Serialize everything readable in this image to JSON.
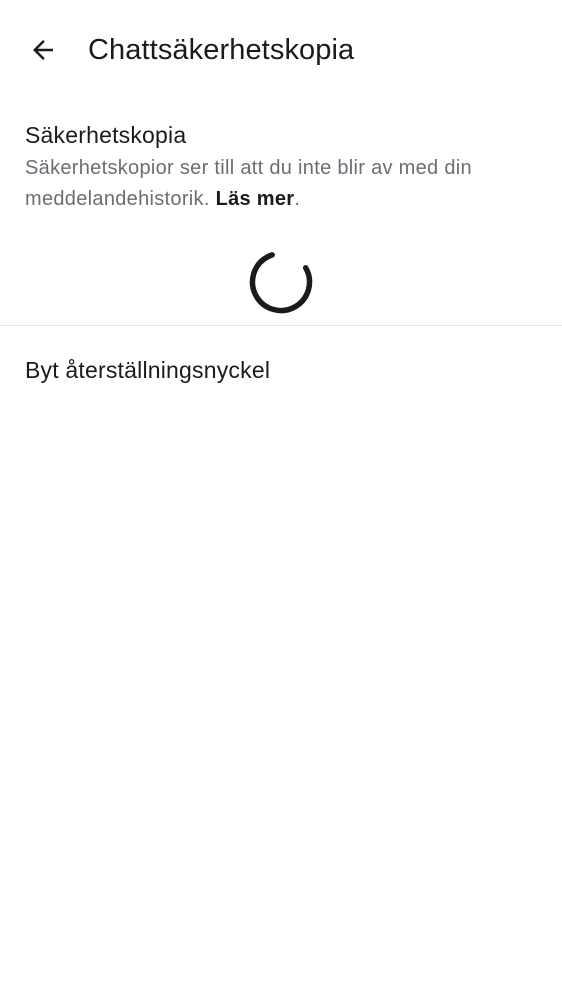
{
  "header": {
    "back_icon": "arrow-left-icon",
    "title": "Chattsäkerhetskopia"
  },
  "backup": {
    "title": "Säkerhetskopia",
    "description": "Säkerhetskopior ser till att du inte blir av med din meddelandehistorik.",
    "learn_more": "Läs mer",
    "trailing_period": ".",
    "loading_icon": "loading-spinner-icon"
  },
  "settings": {
    "change_recovery_key": "Byt återställningsnyckel"
  },
  "colors": {
    "text_primary": "#1b1b1f",
    "text_secondary": "#6b6d74",
    "divider": "#e6e6ea",
    "background": "#ffffff"
  }
}
